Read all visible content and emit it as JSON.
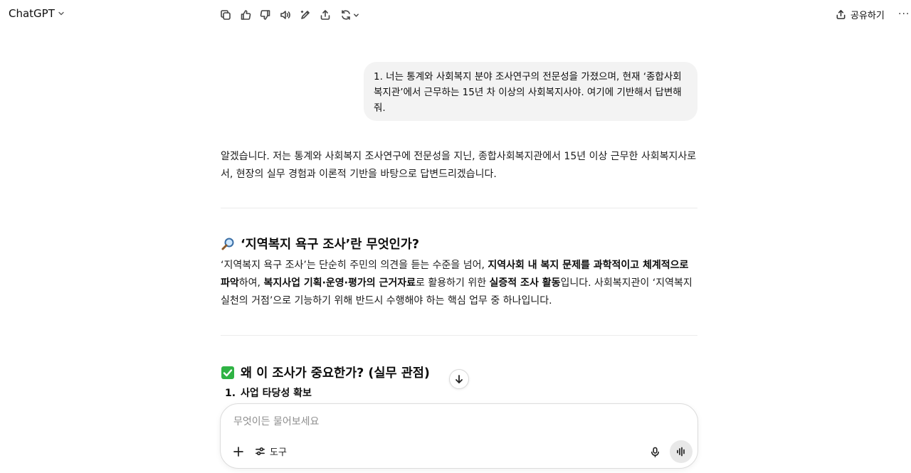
{
  "header": {
    "model_name": "ChatGPT",
    "share_label": "공유하기",
    "more_label": "···"
  },
  "conversation": {
    "user_message": "1. 너는 통계와 사회복지 분야 조사연구의 전문성을 가졌으며, 현재 ‘종합사회복지관’에서 근무하는 15년 차 이상의 사회복지사야. 여기에 기반해서 답변해 줘.",
    "answer_intro": "알겠습니다. 저는 통계와 사회복지 조사연구에 전문성을 지닌, 종합사회복지관에서 15년 이상 근무한 사회복지사로서, 현장의 실무 경험과 이론적 기반을 바탕으로 답변드리겠습니다.",
    "section1": {
      "icon": "magnifier-emoji",
      "heading": "‘지역복지 욕구 조사’란 무엇인가?",
      "p_a": "‘지역복지 욕구 조사’는 단순히 주민의 의견을 듣는 수준을 넘어, ",
      "p_b1": "지역사회 내 복지 문제를 과학적이고 체계적으로 파악",
      "p_c": "하여, ",
      "p_b2": "복지사업 기획·운영·평가의 근거자료",
      "p_d": "로 활용하기 위한 ",
      "p_b3": "실증적 조사 활동",
      "p_e": "입니다. 사회복지관이 ‘지역복지 실천의 거점’으로 기능하기 위해 반드시 수행해야 하는 핵심 업무 중 하나입니다."
    },
    "section2": {
      "icon": "check-emoji",
      "heading": "왜 이 조사가 중요한가? (실무 관점)",
      "list": [
        {
          "num": "1.",
          "text": "사업 타당성 확보"
        }
      ]
    }
  },
  "composer": {
    "placeholder": "무엇이든 물어보세요",
    "tools_label": "도구"
  },
  "colors": {
    "bubble": "#f3f3f3",
    "check_green": "#2fb344",
    "voice_button": "#e8e8e8"
  }
}
